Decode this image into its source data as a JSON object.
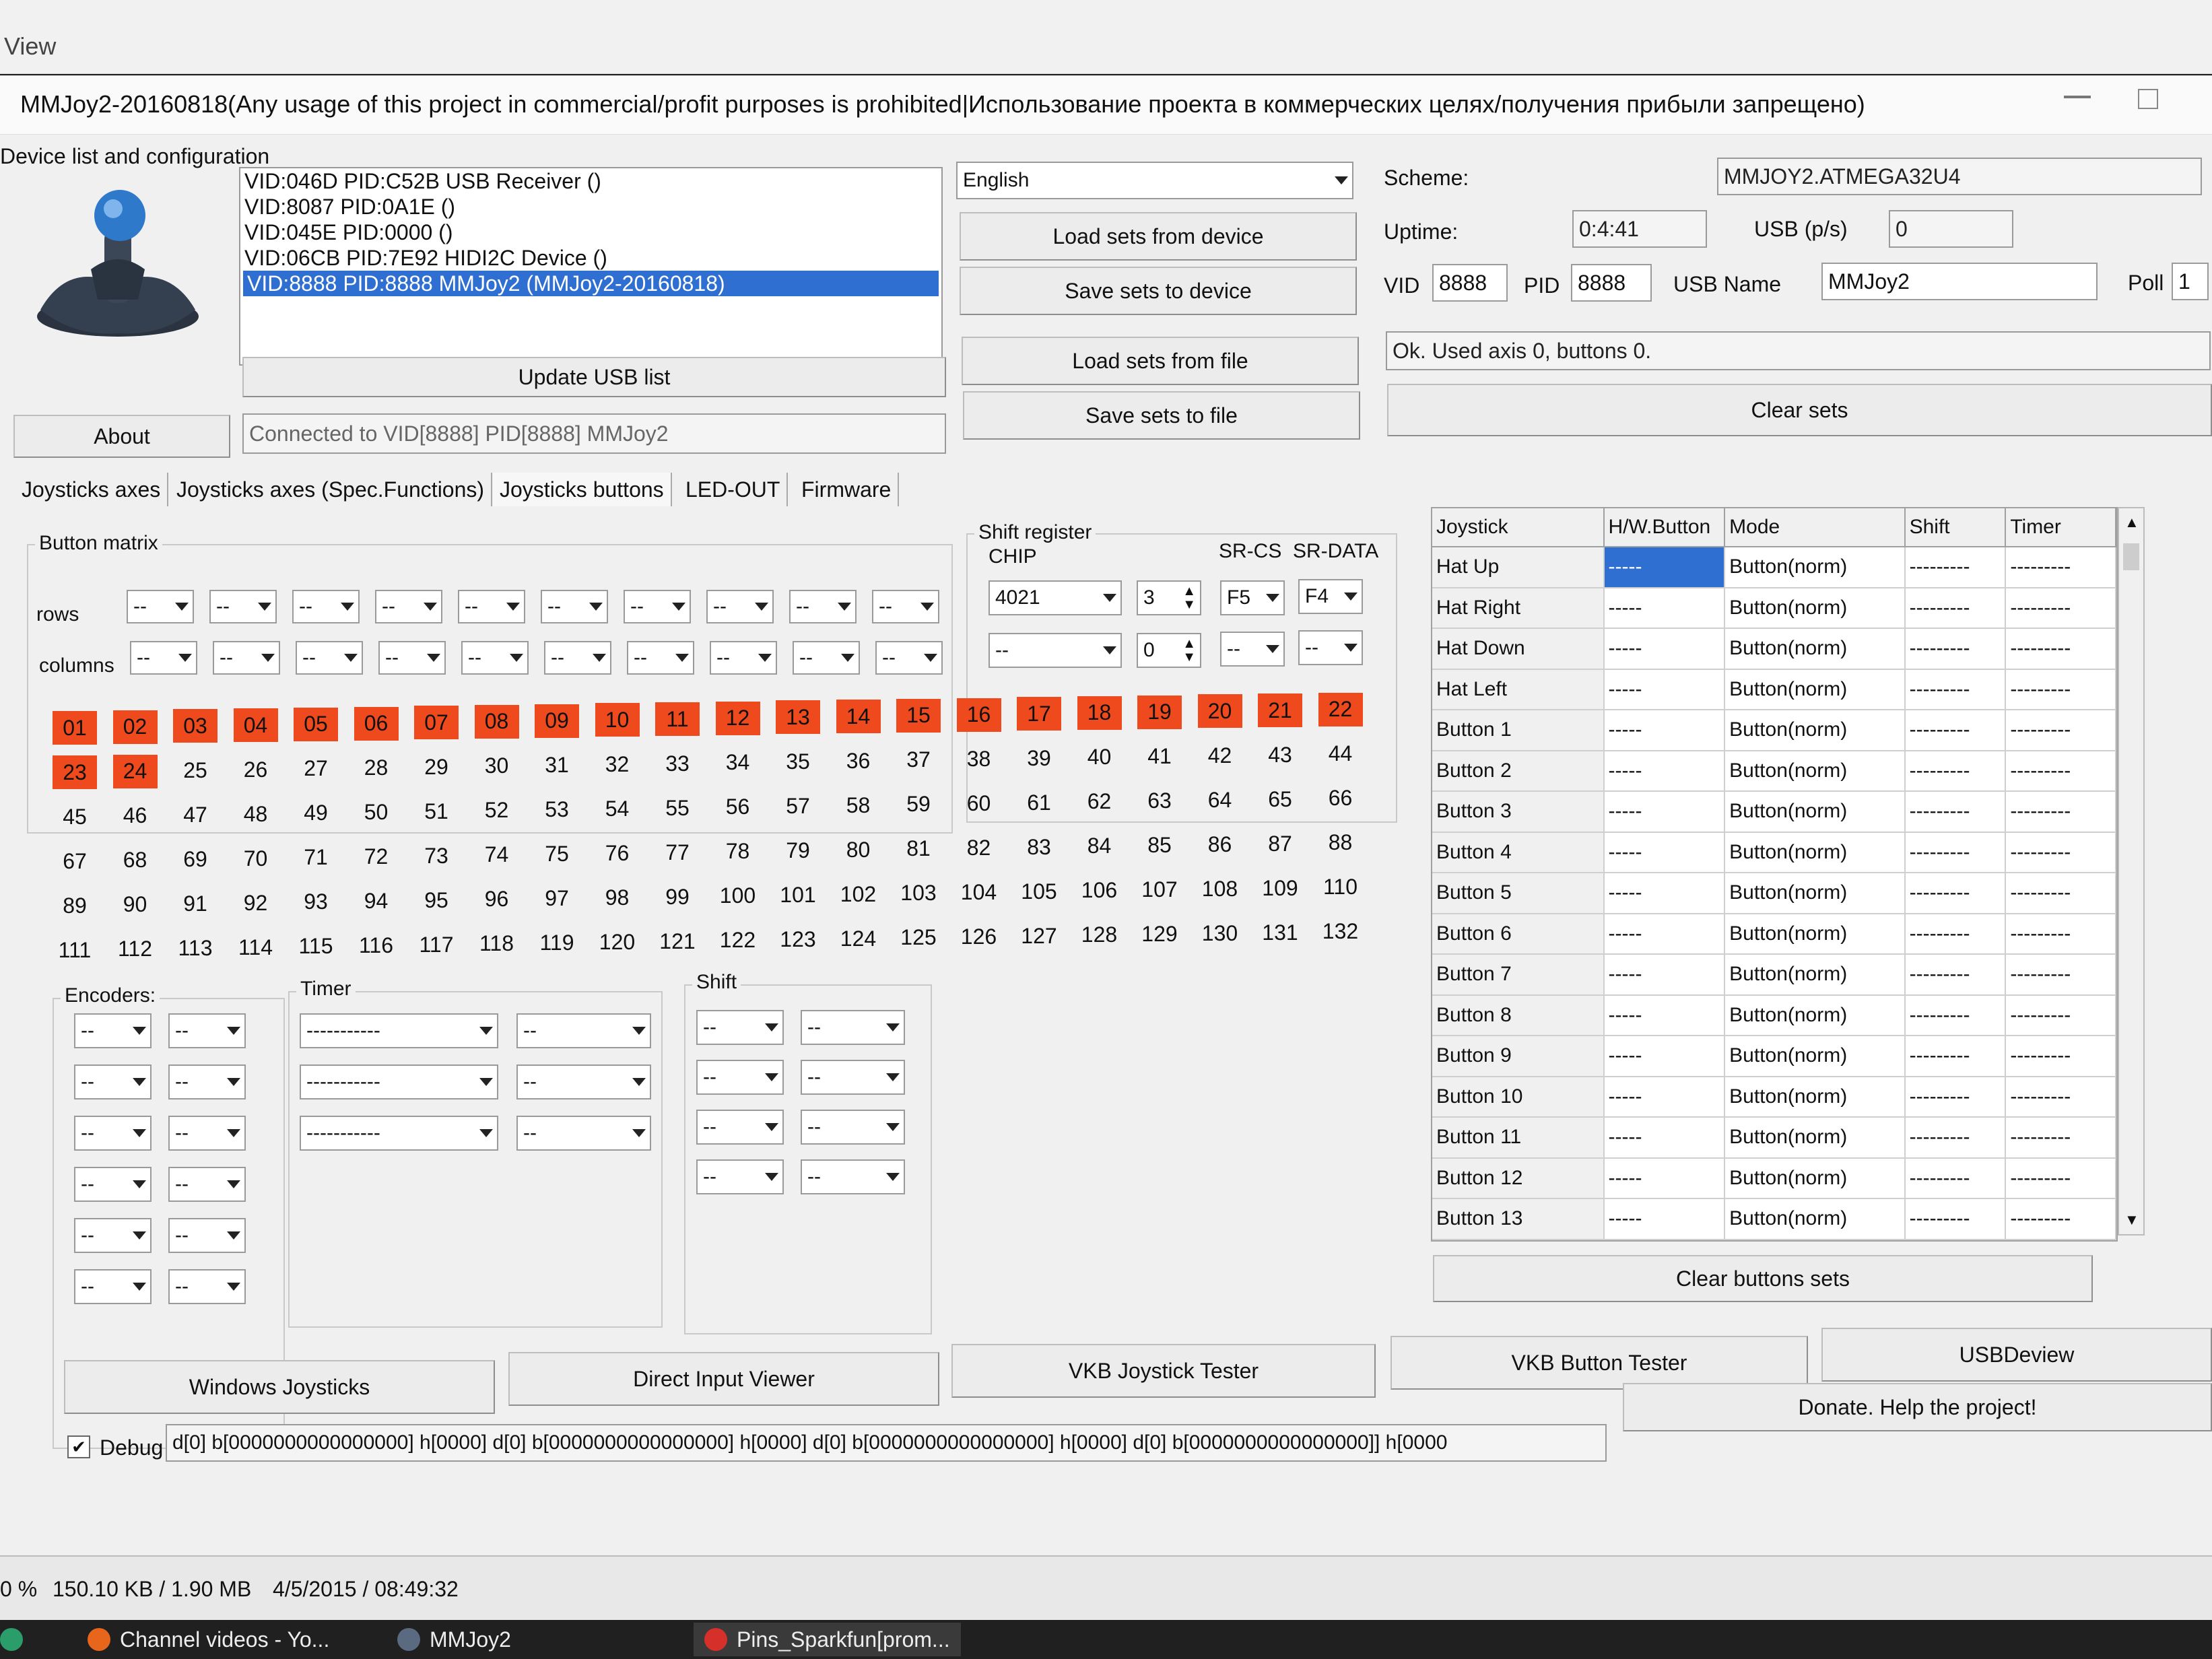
{
  "outer": {
    "menu_label": "View"
  },
  "window": {
    "title": "MMJoy2-20160818(Any usage of this project in commercial/profit purposes is prohibited|Использование проекта в коммерческих целях/получения прибыли запрещено)"
  },
  "device": {
    "group_label": "Device list and configuration",
    "items": [
      "VID:046D PID:C52B USB Receiver ()",
      "VID:8087 PID:0A1E  ()",
      "VID:045E PID:0000  ()",
      "VID:06CB PID:7E92 HIDI2C Device ()",
      "VID:8888 PID:8888 MMJoy2 (MMJoy2-20160818)"
    ],
    "update_button": "Update USB list",
    "about_button": "About",
    "connected_text": "Connected to VID[8888] PID[8888] MMJoy2"
  },
  "language": {
    "selected": "English"
  },
  "sets": {
    "load_device": "Load sets from device",
    "save_device": "Save sets to device",
    "load_file": "Load sets from file",
    "save_file": "Save sets to file"
  },
  "info": {
    "scheme_label": "Scheme:",
    "scheme_value": "MMJOY2.ATMEGA32U4",
    "uptime_label": "Uptime:",
    "uptime_value": "0:4:41",
    "usb_label": "USB (p/s)",
    "usb_value": "0",
    "vid_label": "VID",
    "vid_value": "8888",
    "pid_label": "PID",
    "pid_value": "8888",
    "usbname_label": "USB Name",
    "usbname_value": "MMJoy2",
    "poll_label": "Poll",
    "poll_value": "1",
    "status_text": "Ok. Used axis  0, buttons 0.",
    "clear_sets": "Clear sets"
  },
  "tabs": [
    "Joysticks axes",
    "Joysticks axes (Spec.Functions)",
    "Joysticks buttons",
    "LED-OUT",
    "Firmware"
  ],
  "matrix": {
    "group_label": "Button matrix",
    "rows_label": "rows",
    "columns_label": "columns",
    "combo_value": "--"
  },
  "shift_register": {
    "group_label": "Shift register",
    "chip_label": "CHIP",
    "srcs_label": "SR-CS",
    "srdata_label": "SR-DATA",
    "chip1": "4021",
    "count1": "3",
    "cs1": "F5",
    "data1": "F4",
    "chip2": "--",
    "count2": "0",
    "cs2": "--",
    "data2": "--"
  },
  "buttons_grid": {
    "active_count": 24,
    "labels": [
      "01",
      "02",
      "03",
      "04",
      "05",
      "06",
      "07",
      "08",
      "09",
      "10",
      "11",
      "12",
      "13",
      "14",
      "15",
      "16",
      "17",
      "18",
      "19",
      "20",
      "21",
      "22",
      "23",
      "24",
      "25",
      "26",
      "27",
      "28",
      "29",
      "30",
      "31",
      "32",
      "33",
      "34",
      "35",
      "36",
      "37",
      "38",
      "39",
      "40",
      "41",
      "42",
      "43",
      "44",
      "45",
      "46",
      "47",
      "48",
      "49",
      "50",
      "51",
      "52",
      "53",
      "54",
      "55",
      "56",
      "57",
      "58",
      "59",
      "60",
      "61",
      "62",
      "63",
      "64",
      "65",
      "66",
      "67",
      "68",
      "69",
      "70",
      "71",
      "72",
      "73",
      "74",
      "75",
      "76",
      "77",
      "78",
      "79",
      "80",
      "81",
      "82",
      "83",
      "84",
      "85",
      "86",
      "87",
      "88",
      "89",
      "90",
      "91",
      "92",
      "93",
      "94",
      "95",
      "96",
      "97",
      "98",
      "99",
      "100",
      "101",
      "102",
      "103",
      "104",
      "105",
      "106",
      "107",
      "108",
      "109",
      "110",
      "111",
      "112",
      "113",
      "114",
      "115",
      "116",
      "117",
      "118",
      "119",
      "120",
      "121",
      "122",
      "123",
      "124",
      "125",
      "126",
      "127",
      "128",
      "129",
      "130",
      "131",
      "132"
    ]
  },
  "encoders": {
    "label": "Encoders:",
    "value": "--"
  },
  "timer": {
    "label": "Timer",
    "value_a": "-----------",
    "value_b": "--"
  },
  "shift": {
    "label": "Shift",
    "value": "--"
  },
  "table": {
    "headers": [
      "Joystick",
      "H/W.Button",
      "Mode",
      "Shift",
      "Timer"
    ],
    "rows": [
      {
        "name": "Hat Up",
        "hw": "-----",
        "mode": "Button(norm)",
        "shift": "---------",
        "timer": "---------"
      },
      {
        "name": "Hat Right",
        "hw": "-----",
        "mode": "Button(norm)",
        "shift": "---------",
        "timer": "---------"
      },
      {
        "name": "Hat Down",
        "hw": "-----",
        "mode": "Button(norm)",
        "shift": "---------",
        "timer": "---------"
      },
      {
        "name": "Hat Left",
        "hw": "-----",
        "mode": "Button(norm)",
        "shift": "---------",
        "timer": "---------"
      },
      {
        "name": "Button 1",
        "hw": "-----",
        "mode": "Button(norm)",
        "shift": "---------",
        "timer": "---------"
      },
      {
        "name": "Button 2",
        "hw": "-----",
        "mode": "Button(norm)",
        "shift": "---------",
        "timer": "---------"
      },
      {
        "name": "Button 3",
        "hw": "-----",
        "mode": "Button(norm)",
        "shift": "---------",
        "timer": "---------"
      },
      {
        "name": "Button 4",
        "hw": "-----",
        "mode": "Button(norm)",
        "shift": "---------",
        "timer": "---------"
      },
      {
        "name": "Button 5",
        "hw": "-----",
        "mode": "Button(norm)",
        "shift": "---------",
        "timer": "---------"
      },
      {
        "name": "Button 6",
        "hw": "-----",
        "mode": "Button(norm)",
        "shift": "---------",
        "timer": "---------"
      },
      {
        "name": "Button 7",
        "hw": "-----",
        "mode": "Button(norm)",
        "shift": "---------",
        "timer": "---------"
      },
      {
        "name": "Button 8",
        "hw": "-----",
        "mode": "Button(norm)",
        "shift": "---------",
        "timer": "---------"
      },
      {
        "name": "Button 9",
        "hw": "-----",
        "mode": "Button(norm)",
        "shift": "---------",
        "timer": "---------"
      },
      {
        "name": "Button 10",
        "hw": "-----",
        "mode": "Button(norm)",
        "shift": "---------",
        "timer": "---------"
      },
      {
        "name": "Button 11",
        "hw": "-----",
        "mode": "Button(norm)",
        "shift": "---------",
        "timer": "---------"
      },
      {
        "name": "Button 12",
        "hw": "-----",
        "mode": "Button(norm)",
        "shift": "---------",
        "timer": "---------"
      },
      {
        "name": "Button 13",
        "hw": "-----",
        "mode": "Button(norm)",
        "shift": "---------",
        "timer": "---------"
      }
    ],
    "clear_buttons": "Clear buttons sets"
  },
  "bottom": {
    "windows_joysticks": "Windows Joysticks",
    "direct_input": "Direct Input Viewer",
    "vkb_joystick": "VKB Joystick Tester",
    "vkb_button": "VKB Button Tester",
    "usbdeview": "USBDeview",
    "donate": "Donate. Help the project!",
    "debug_label": "Debug",
    "debug_text": "d[0] b[0000000000000000] h[0000]   d[0] b[0000000000000000] h[0000]   d[0] b[0000000000000000] h[0000]   d[0] b[0000000000000000]] h[0000"
  },
  "statusbar": {
    "percent": "0 %",
    "size": "150.10 KB / 1.90 MB",
    "date": "4/5/2015 / 08:49:32"
  },
  "taskbar": {
    "item1": "Channel videos - Yo...",
    "item2": "MMJoy2",
    "item3": "Pins_Sparkfun[prom..."
  },
  "colors": {
    "active_button": "#ee4a1e",
    "selection": "#2f6fd1"
  }
}
